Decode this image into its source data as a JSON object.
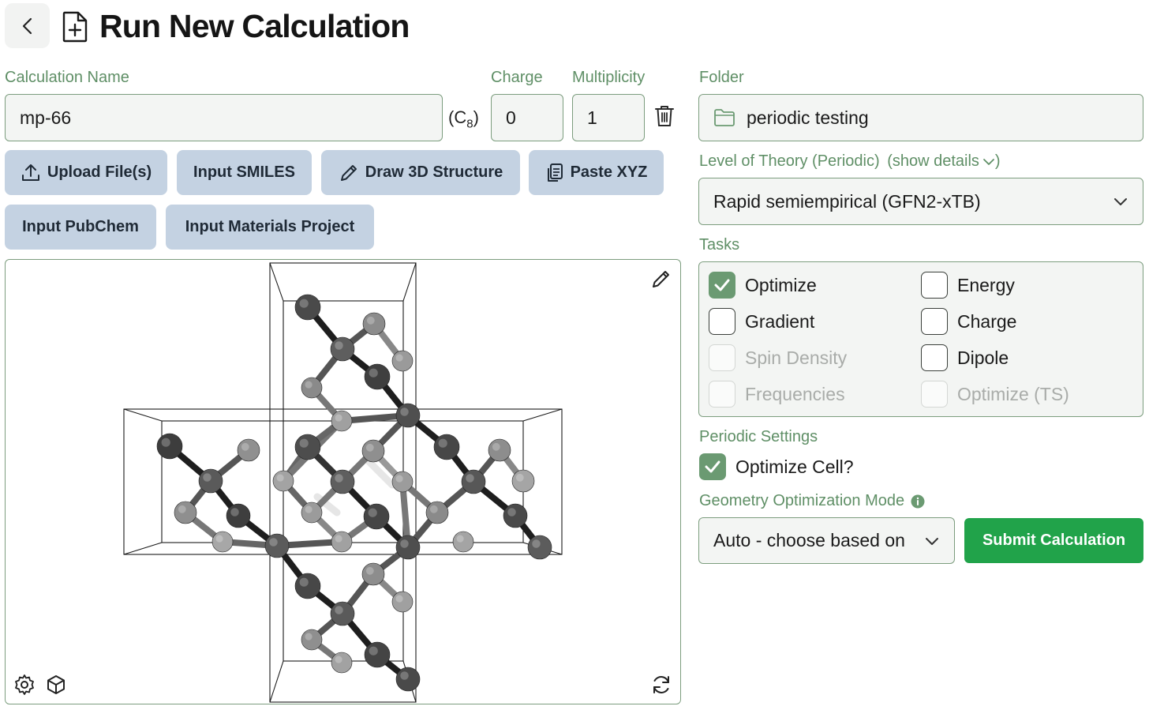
{
  "header": {
    "title": "Run New Calculation"
  },
  "form": {
    "name_label": "Calculation Name",
    "name_value": "mp-66",
    "formula_prefix": "(C",
    "formula_sub": "8",
    "formula_suffix": ")",
    "charge_label": "Charge",
    "charge_value": "0",
    "multiplicity_label": "Multiplicity",
    "multiplicity_value": "1"
  },
  "sources": {
    "upload": "Upload File(s)",
    "smiles": "Input SMILES",
    "draw": "Draw 3D Structure",
    "paste": "Paste XYZ",
    "pubchem": "Input PubChem",
    "materials": "Input Materials Project"
  },
  "folder": {
    "label": "Folder",
    "value": "periodic testing"
  },
  "theory": {
    "label": "Level of Theory (Periodic)",
    "details_link": "(show details",
    "value": "Rapid semiempirical (GFN2-xTB)"
  },
  "tasks": {
    "label": "Tasks",
    "items": [
      {
        "label": "Optimize",
        "checked": true,
        "enabled": true
      },
      {
        "label": "Energy",
        "checked": false,
        "enabled": true
      },
      {
        "label": "Gradient",
        "checked": false,
        "enabled": true
      },
      {
        "label": "Charge",
        "checked": false,
        "enabled": true
      },
      {
        "label": "Spin Density",
        "checked": false,
        "enabled": false
      },
      {
        "label": "Dipole",
        "checked": false,
        "enabled": true
      },
      {
        "label": "Frequencies",
        "checked": false,
        "enabled": false
      },
      {
        "label": "Optimize (TS)",
        "checked": false,
        "enabled": false
      }
    ]
  },
  "periodic": {
    "label": "Periodic Settings",
    "optimize_cell_label": "Optimize Cell?",
    "optimize_cell_checked": true
  },
  "geometry": {
    "label": "Geometry Optimization Mode",
    "value": "Auto - choose based on"
  },
  "submit_label": "Submit Calculation",
  "colors": {
    "accent_green": "#5f8f66",
    "submit_green": "#21a34a",
    "source_button": "#c4d2e2"
  }
}
